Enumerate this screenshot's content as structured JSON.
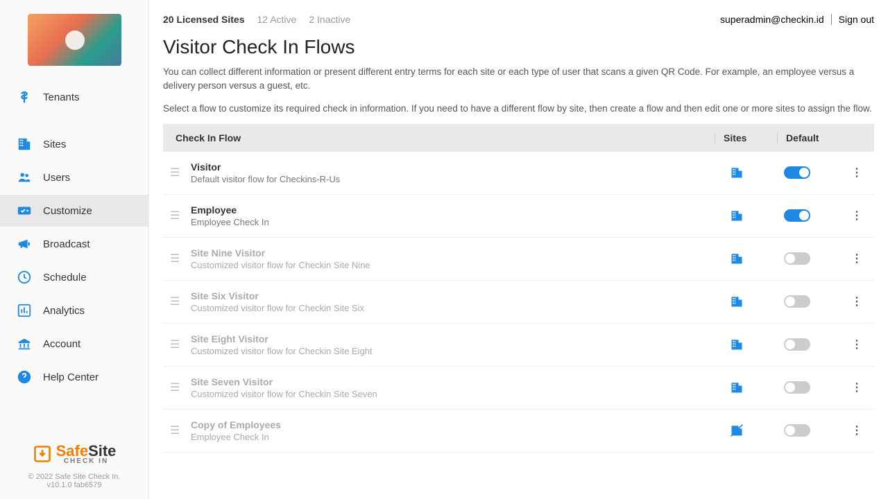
{
  "header": {
    "licensed": "20 Licensed Sites",
    "active": "12 Active",
    "inactive": "2 Inactive",
    "user": "superadmin@checkin.id",
    "signout": "Sign out"
  },
  "page": {
    "title": "Visitor Check In Flows",
    "desc1": "You can collect different information or present different entry terms for each site or each type of user that scans a given QR Code. For example, an employee versus a delivery person versus a guest, etc.",
    "desc2": "Select a flow to customize its required check in information. If you need to have a different flow by site, then create a flow and then edit one or more sites to assign the flow."
  },
  "columns": {
    "flow": "Check In Flow",
    "sites": "Sites",
    "default": "Default"
  },
  "sidebar": {
    "items": [
      {
        "label": "Tenants",
        "icon": "dollar"
      },
      {
        "label": "Sites",
        "icon": "building"
      },
      {
        "label": "Users",
        "icon": "users"
      },
      {
        "label": "Customize",
        "icon": "customize",
        "active": true
      },
      {
        "label": "Broadcast",
        "icon": "bullhorn"
      },
      {
        "label": "Schedule",
        "icon": "clock"
      },
      {
        "label": "Analytics",
        "icon": "chart"
      },
      {
        "label": "Account",
        "icon": "bank"
      },
      {
        "label": "Help Center",
        "icon": "help"
      }
    ]
  },
  "flows": [
    {
      "title": "Visitor",
      "desc": "Default visitor flow for Checkins-R-Us",
      "default": true,
      "enabled": true,
      "strike": false
    },
    {
      "title": "Employee",
      "desc": "Employee Check In",
      "default": true,
      "enabled": true,
      "strike": false
    },
    {
      "title": "Site Nine Visitor",
      "desc": "Customized visitor flow for Checkin Site Nine",
      "default": false,
      "enabled": false,
      "strike": false
    },
    {
      "title": "Site Six Visitor",
      "desc": "Customized visitor flow for Checkin Site Six",
      "default": false,
      "enabled": false,
      "strike": false
    },
    {
      "title": "Site Eight Visitor",
      "desc": "Customized visitor flow for Checkin Site Eight",
      "default": false,
      "enabled": false,
      "strike": false
    },
    {
      "title": "Site Seven Visitor",
      "desc": "Customized visitor flow for Checkin Site Seven",
      "default": false,
      "enabled": false,
      "strike": false
    },
    {
      "title": "Copy of Employees",
      "desc": "Employee Check In",
      "default": false,
      "enabled": false,
      "strike": true
    }
  ],
  "footer": {
    "brand_safe": "Safe",
    "brand_site": "Site",
    "brand_sub": "CHECK IN",
    "copy": "© 2022 Safe Site Check In.",
    "version": "v10.1.0 fab6579"
  }
}
